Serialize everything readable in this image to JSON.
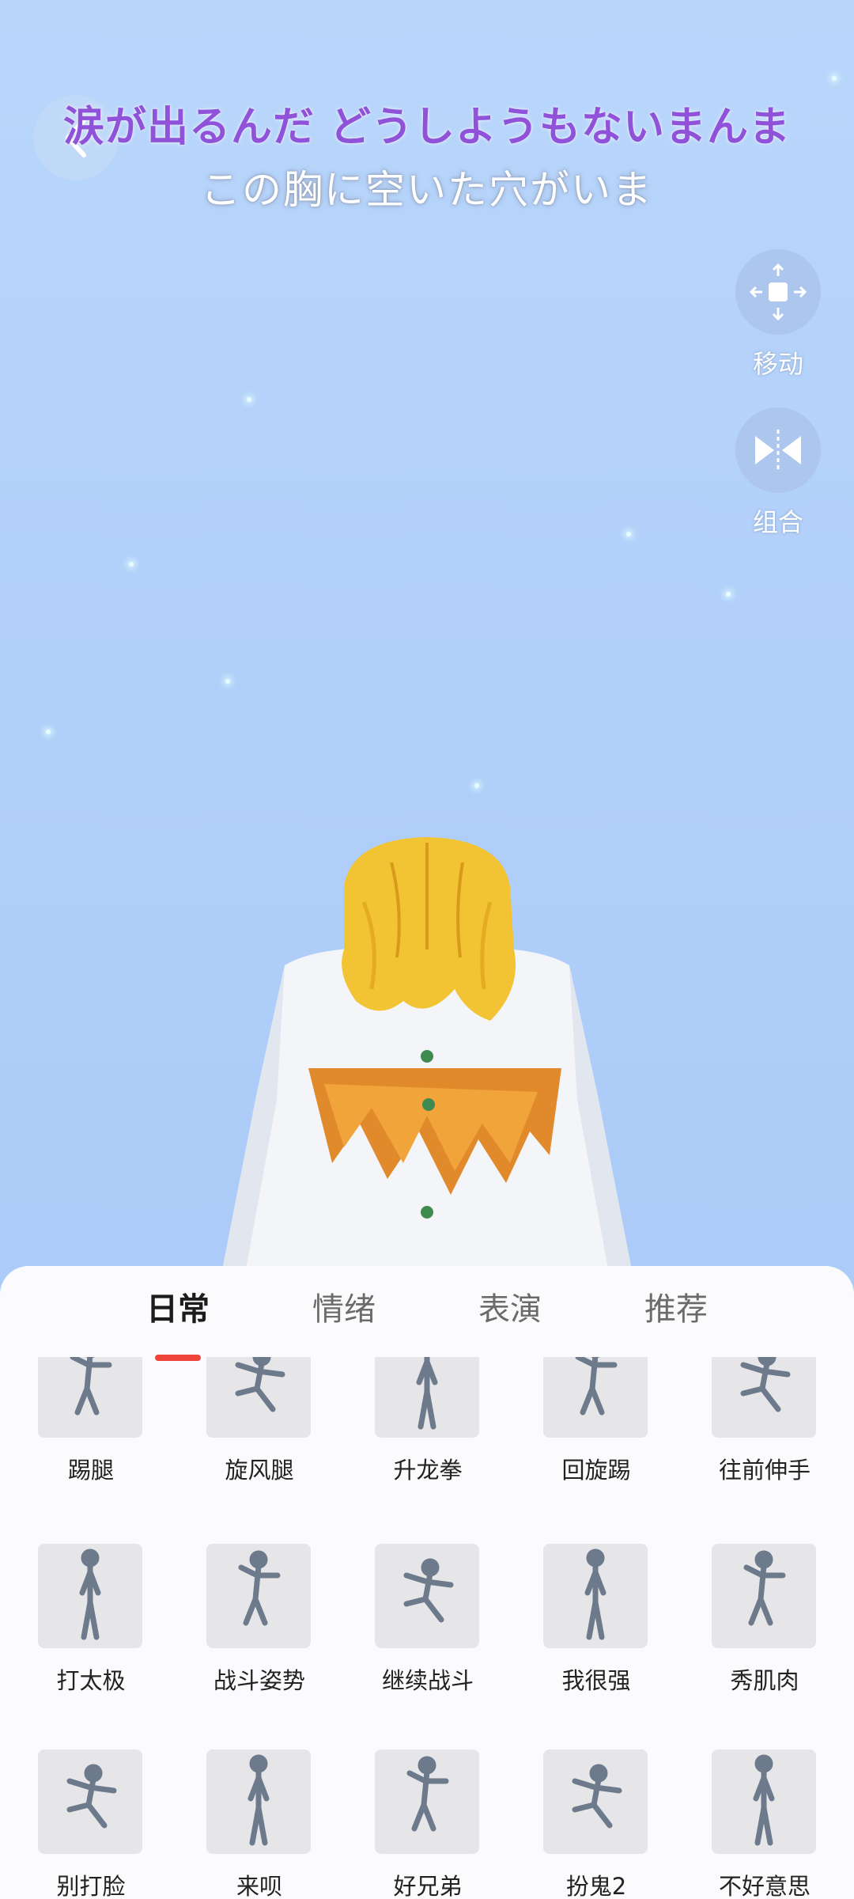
{
  "lyrics": {
    "line1": "涙が出るんだ どうしようもないまんま",
    "line2": "この胸に空いた穴がいま"
  },
  "side_controls": {
    "move_label": "移动",
    "combine_label": "组合"
  },
  "tabs": [
    {
      "label": "日常",
      "active": true
    },
    {
      "label": "情绪",
      "active": false
    },
    {
      "label": "表演",
      "active": false
    },
    {
      "label": "推荐",
      "active": false
    }
  ],
  "poses": [
    {
      "label": "踢腿"
    },
    {
      "label": "旋风腿"
    },
    {
      "label": "升龙拳"
    },
    {
      "label": "回旋踢"
    },
    {
      "label": "往前伸手"
    },
    {
      "label": "打太极"
    },
    {
      "label": "战斗姿势"
    },
    {
      "label": "继续战斗"
    },
    {
      "label": "我很强"
    },
    {
      "label": "秀肌肉"
    },
    {
      "label": "别打脸"
    },
    {
      "label": "来呗"
    },
    {
      "label": "好兄弟"
    },
    {
      "label": "扮鬼2"
    },
    {
      "label": "不好意思"
    }
  ],
  "colors": {
    "accent": "#f0453a",
    "lyric_highlight": "#8f52d8",
    "figure": "#6c7a8c"
  }
}
